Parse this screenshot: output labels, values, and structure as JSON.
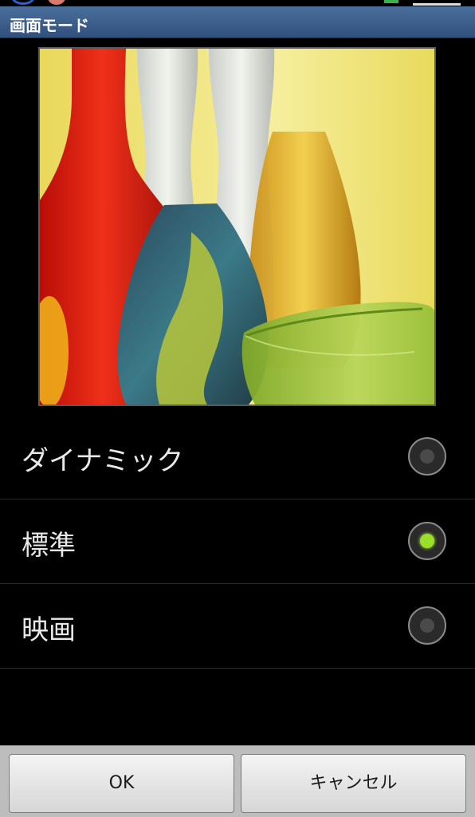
{
  "dialog": {
    "title": "画面モード"
  },
  "preview": {
    "image": "glass-vases-photo"
  },
  "modes": [
    {
      "label": "ダイナミック",
      "selected": false
    },
    {
      "label": "標準",
      "selected": true
    },
    {
      "label": "映画",
      "selected": false
    }
  ],
  "buttons": {
    "ok_label": "OK",
    "cancel_label": "キャンセル"
  },
  "colors": {
    "title_bar": "#3a5f8e",
    "radio_selected": "#9adf2a",
    "background": "#000000"
  }
}
